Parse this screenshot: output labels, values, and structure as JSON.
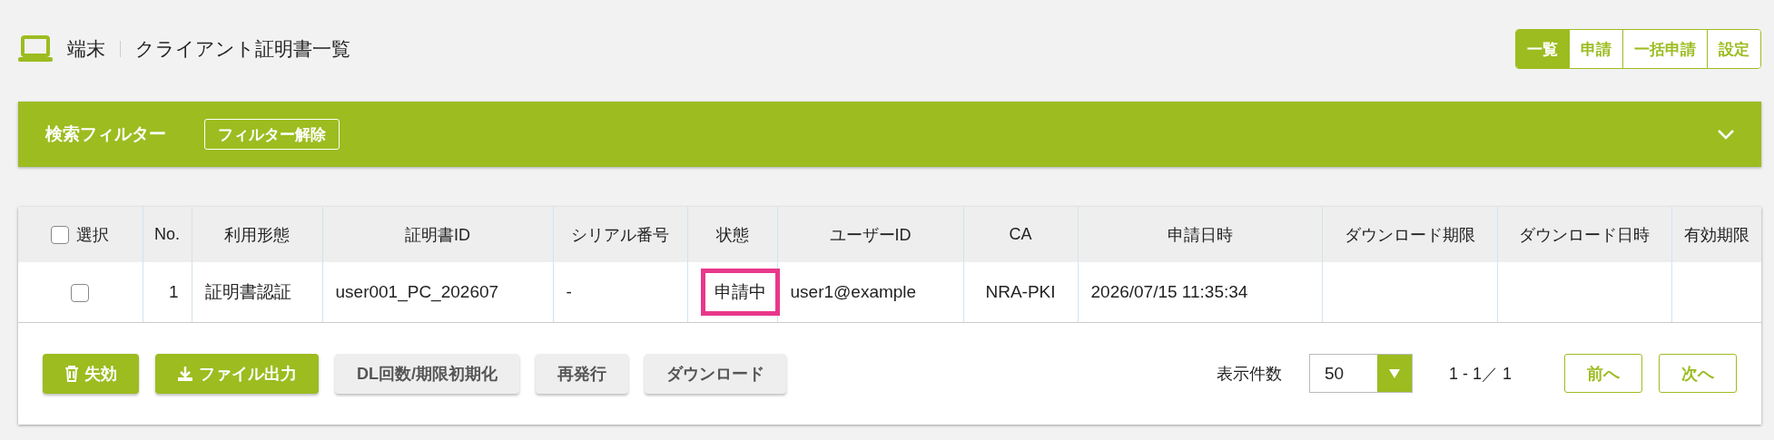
{
  "header": {
    "section": "端末",
    "title": "クライアント証明書一覧"
  },
  "tabs": [
    {
      "label": "一覧",
      "selected": true
    },
    {
      "label": "申請",
      "selected": false
    },
    {
      "label": "一括申請",
      "selected": false
    },
    {
      "label": "設定",
      "selected": false
    }
  ],
  "filter": {
    "title": "検索フィルター",
    "clear_button": "フィルター解除",
    "expanded": false
  },
  "table": {
    "select_all": {
      "label": "選択",
      "checked": false
    },
    "columns": [
      "No.",
      "利用形態",
      "証明書ID",
      "シリアル番号",
      "状態",
      "ユーザーID",
      "CA",
      "申請日時",
      "ダウンロード期限",
      "ダウンロード日時",
      "有効期限"
    ],
    "rows": [
      {
        "checked": false,
        "cells": [
          "1",
          "証明書認証",
          "user001_PC_202607",
          "-",
          "申請中",
          "user1@example",
          "NRA-PKI",
          "2026/07/15 11:35:34",
          "",
          "",
          ""
        ],
        "status_highlighted": true
      }
    ]
  },
  "actions": [
    {
      "label": "失効",
      "kind": "primary"
    },
    {
      "label": "ファイル出力",
      "kind": "primary"
    },
    {
      "label": "DL回数/期限初期化",
      "kind": "disabled"
    },
    {
      "label": "再発行",
      "kind": "disabled"
    },
    {
      "label": "ダウンロード",
      "kind": "disabled"
    }
  ],
  "pagination": {
    "page_size_label": "表示件数",
    "page_size": "50",
    "range": "1 - 1／ 1",
    "prev": "前へ",
    "next": "次へ"
  }
}
